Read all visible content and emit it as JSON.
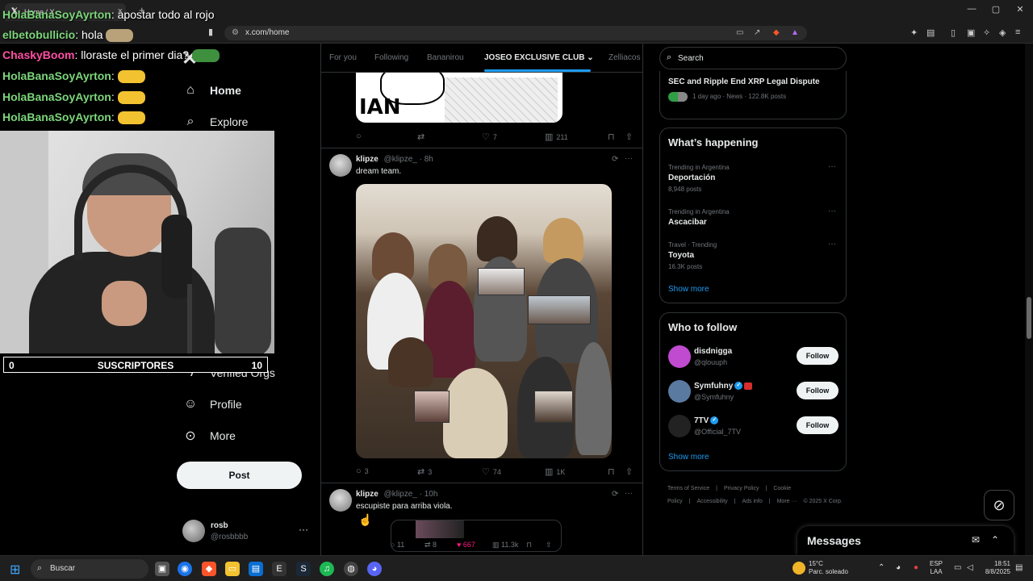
{
  "browser": {
    "tab_title": "Home / X",
    "url": "x.com/home"
  },
  "stream": {
    "chat": [
      {
        "user": "HolaBanaSoyAyrton",
        "color": "#7cd67a",
        "text": ": apostar todo al rojo",
        "emote": ""
      },
      {
        "user": "elbetobullicio",
        "color": "#7cd67a",
        "text": ": hola",
        "emote": "#b9a27a"
      },
      {
        "user": "ChaskyBoom",
        "color": "#ff4fa3",
        "text": ": lloraste el primer dia?",
        "emote": "#3e8f3e"
      },
      {
        "user": "HolaBanaSoyAyrton",
        "color": "#7cd67a",
        "text": ":",
        "emote": "#f2c230"
      },
      {
        "user": "HolaBanaSoyAyrton",
        "color": "#7cd67a",
        "text": ":",
        "emote": "#f2c230"
      },
      {
        "user": "HolaBanaSoyAyrton",
        "color": "#7cd67a",
        "text": ":",
        "emote": "#f2c230"
      }
    ],
    "subs_left": "0",
    "subs_label": "SUSCRIPTORES",
    "subs_right": "10"
  },
  "nav": {
    "home": "Home",
    "explore": "Explore",
    "verified_orgs": "Verified Orgs",
    "profile": "Profile",
    "more": "More",
    "post": "Post",
    "account_name": "rosb",
    "account_handle": "@rosbbbb"
  },
  "timeline": {
    "tabs": [
      "For you",
      "Following",
      "Bananirou",
      "JOSEO EXCLUSIVE CLUB",
      "Zelliacos"
    ],
    "active_tab": 3,
    "meme_text": "IAN",
    "tweet0_actions": {
      "replies": "",
      "reposts": "",
      "likes": "7",
      "views": "211"
    },
    "tweet1": {
      "name": "klipze",
      "handle": "@klipze_ · 8h",
      "text": "dream team.",
      "replies": "3",
      "reposts": "3",
      "likes": "74",
      "views": "1K"
    },
    "tweet2": {
      "name": "klipze",
      "handle": "@klipze_ · 10h",
      "text": "escupiste para arriba viola.",
      "replies": "11",
      "reposts": "8",
      "likes": "667",
      "views": "11.3k"
    }
  },
  "right": {
    "search_placeholder": "Search",
    "news_title": "SEC and Ripple End XRP Legal Dispute",
    "news_meta": "1 day ago · News · 122.8K posts",
    "whats_happening": "What’s happening",
    "trends": [
      {
        "cat": "Trending in Argentina",
        "name": "Deportación",
        "posts": "8,948 posts"
      },
      {
        "cat": "Trending in Argentina",
        "name": "Ascacibar",
        "posts": ""
      },
      {
        "cat": "Travel · Trending",
        "name": "Toyota",
        "posts": "16.3K posts"
      }
    ],
    "show_more": "Show more",
    "who_to_follow": "Who to follow",
    "follow_label": "Follow",
    "accounts": [
      {
        "name": "disdnigga",
        "handle": "@qlouuph",
        "color": "#c04ad0"
      },
      {
        "name": "Symfuhny",
        "handle": "@Symfuhny",
        "color": "#5a7aa0"
      },
      {
        "name": "7TV",
        "handle": "@Official_7TV",
        "color": "#222222"
      }
    ],
    "footer": [
      "Terms of Service",
      "|",
      "Privacy Policy",
      "|",
      "Cookie Policy",
      "|",
      "Accessibility",
      "|",
      "Ads info",
      "|",
      "More ···",
      "© 2025 X Corp."
    ],
    "messages": "Messages"
  },
  "taskbar": {
    "search": "Buscar",
    "temp": "15°C",
    "weather": "Parc. soleado",
    "lang1": "ESP",
    "lang2": "LAA",
    "time": "18:51",
    "date": "8/8/2025"
  }
}
